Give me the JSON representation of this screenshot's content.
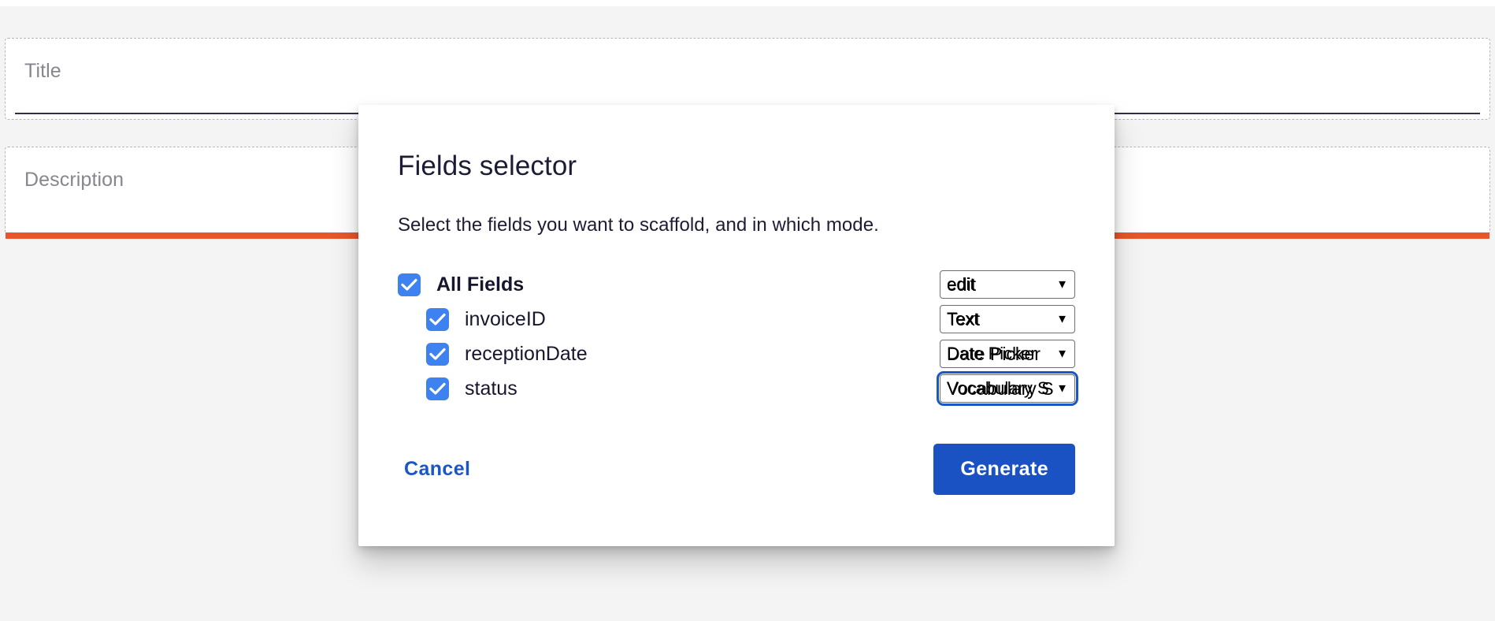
{
  "background_form": {
    "fields": [
      {
        "placeholder": "Title",
        "state": "normal"
      },
      {
        "placeholder": "Description",
        "state": "error"
      }
    ]
  },
  "modal": {
    "title": "Fields selector",
    "subtitle": "Select the fields you want to scaffold, and in which mode.",
    "rows": [
      {
        "label": "All Fields",
        "checked": true,
        "level": 0,
        "mode": "edit",
        "focused": false
      },
      {
        "label": "invoiceID",
        "checked": true,
        "level": 1,
        "mode": "Text",
        "focused": false
      },
      {
        "label": "receptionDate",
        "checked": true,
        "level": 1,
        "mode": "Date Picker",
        "focused": false
      },
      {
        "label": "status",
        "checked": true,
        "level": 1,
        "mode": "Vocabulary S",
        "focused": true
      }
    ],
    "actions": {
      "cancel_label": "Cancel",
      "generate_label": "Generate"
    }
  },
  "colors": {
    "checkbox_blue": "#3d82f0",
    "primary_blue": "#1a52c4",
    "link_blue": "#1a56c4",
    "error_orange": "#e8562a",
    "page_bg": "#f4f4f5",
    "text_dark": "#16162e",
    "placeholder_gray": "#86868f"
  }
}
